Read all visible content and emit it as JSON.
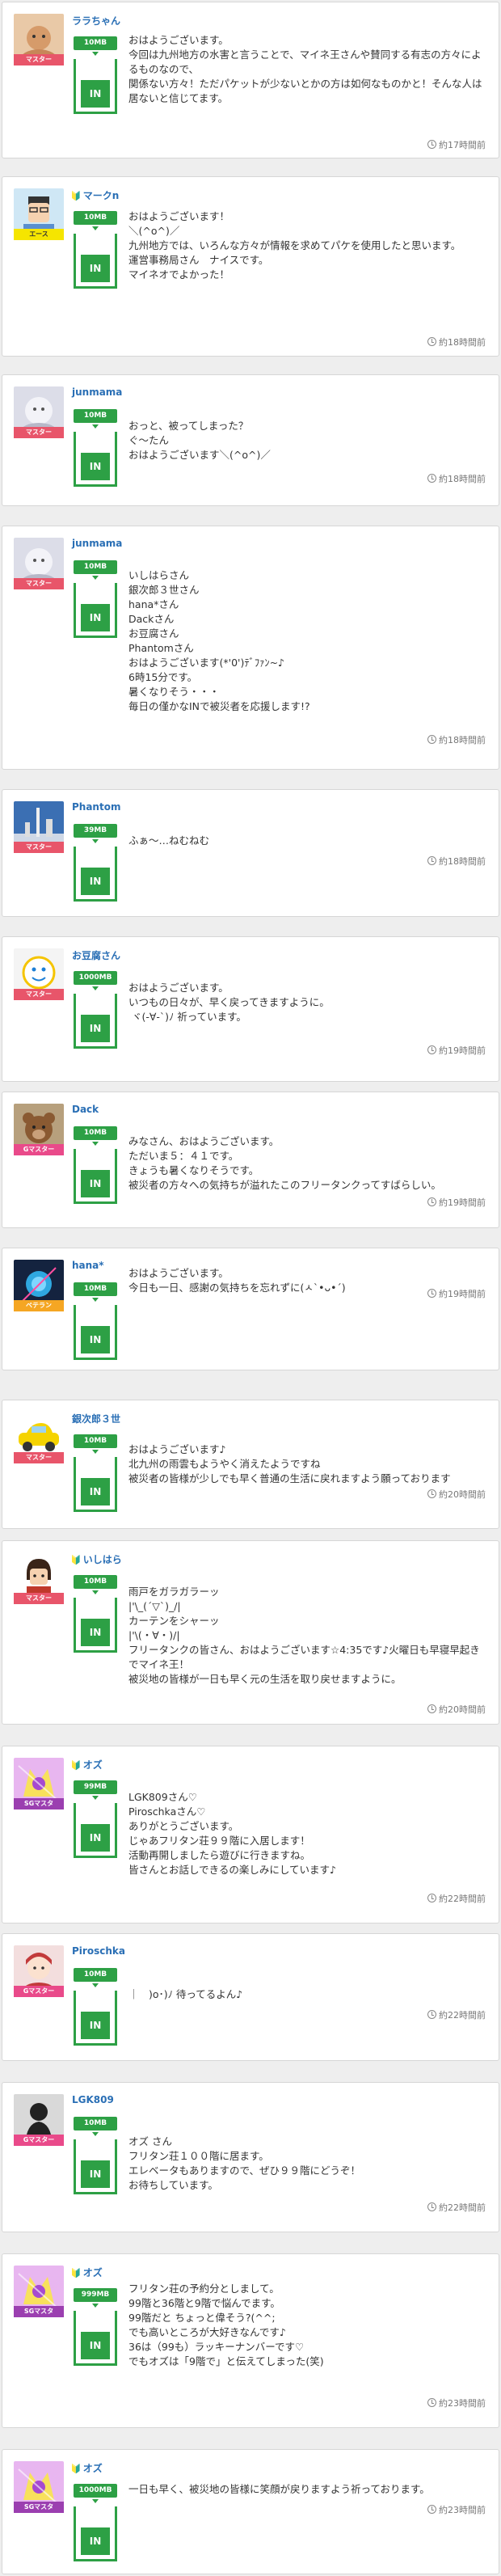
{
  "posts": [
    {
      "user": "ララちゃん",
      "badge": "",
      "rank": "マスター",
      "data": "10MB",
      "button": "IN",
      "time": "約17時間前",
      "message": "おはようございます。\n今回は九州地方の水害と言うことで、マイネ王さんや賛同する有志の方々によるものなので、\n関係ない方々！ただパケットが少ないとかの方は如何なものかと！そんな人は居ないと信じてます。"
    },
    {
      "user": "マークn",
      "badge": "🔰",
      "rank": "エース",
      "data": "10MB",
      "button": "IN",
      "time": "約18時間前",
      "message": "おはようございます！\n＼(^o^)／\n九州地方では、いろんな方々が情報を求めてパケを使用したと思います。\n運営事務局さん　ナイスです。\nマイネオでよかった！"
    },
    {
      "user": "junmama",
      "badge": "",
      "rank": "マスター",
      "data": "10MB",
      "button": "IN",
      "time": "約18時間前",
      "message": "おっと、被ってしまった？\nぐ〜たん\nおはようございます＼(^o^)／"
    },
    {
      "user": "junmama",
      "badge": "",
      "rank": "マスター",
      "data": "10MB",
      "button": "IN",
      "time": "約18時間前",
      "message": "いしはらさん\n銀次郎３世さん\nhana*さん\nDackさん\nお豆腐さん\nPhantomさん\nおはようございます(*'0')ﾃﾞﾌｧﾝ~♪\n6時15分です。\n暑くなりそう・・・\n毎日の僅かなINで被災者を応援します!?"
    },
    {
      "user": "Phantom",
      "badge": "",
      "rank": "マスター",
      "data": "39MB",
      "button": "IN",
      "time": "約18時間前",
      "message": "ふぁ〜…ねむねむ"
    },
    {
      "user": "お豆腐さん",
      "badge": "",
      "rank": "マスター",
      "data": "1000MB",
      "button": "IN",
      "time": "約19時間前",
      "message": "おはようございます。\nいつもの日々が、早く戻ってきますように。\n ヾ(-∀-`)ﾉ 祈っています。"
    },
    {
      "user": "Dack",
      "badge": "",
      "rank": "Gマスター",
      "data": "10MB",
      "button": "IN",
      "time": "約19時間前",
      "message": "みなさん、おはようございます。\nただいま５：４１です。\nきょうも暑くなりそうです。\n被災者の方々への気持ちが溢れたこのフリータンクってすばらしい。"
    },
    {
      "user": "hana*",
      "badge": "",
      "rank": "ベテラン",
      "data": "10MB",
      "button": "IN",
      "time": "約19時間前",
      "message": "おはようございます。\n今日も一日、感謝の気持ちを忘れずに(ㅅ`•ᴗ•´)"
    },
    {
      "user": "銀次郎３世",
      "badge": "",
      "rank": "マスター",
      "data": "10MB",
      "button": "IN",
      "time": "約20時間前",
      "message": "おはようございます♪\n北九州の雨雲もようやく消えたようですね\n被災者の皆様が少しでも早く普通の生活に戻れますよう願っております"
    },
    {
      "user": "いしはら",
      "badge": "🔰",
      "rank": "マスター",
      "data": "10MB",
      "button": "IN",
      "time": "約20時間前",
      "message": "雨戸をガラガラーッ\n|'\\_(´▽`)_/|\nカーテンをシャーッ\n|'\\(・∀・)/|\nフリータンクの皆さん、おはようございます☆4:35です♪火曜日も早寝早起きでマイネ王！\n被災地の皆様が一日も早く元の生活を取り戻せますように。"
    },
    {
      "user": "オズ",
      "badge": "🔰",
      "rank": "SGマスタ",
      "data": "99MB",
      "button": "IN",
      "time": "約22時間前",
      "message": "LGK809さん♡\nPiroschkaさん♡\nありがとうございます。\nじゃあフリタン荘９９階に入居します！\n活動再開しましたら遊びに行きますね。\n皆さんとお話しできるの楽しみにしています♪"
    },
    {
      "user": "Piroschka",
      "badge": "",
      "rank": "Gマスター",
      "data": "10MB",
      "button": "IN",
      "time": "約22時間前",
      "message": "｜　)o･)ﾉ 待ってるよん♪"
    },
    {
      "user": "LGK809",
      "badge": "",
      "rank": "Gマスター",
      "data": "10MB",
      "button": "IN",
      "time": "約22時間前",
      "message": "オズ さん\nフリタン荘１００階に居ます。\nエレベータもありますので、ぜひ９９階にどうぞ！\nお待ちしています。"
    },
    {
      "user": "オズ",
      "badge": "🔰",
      "rank": "SGマスタ",
      "data": "999MB",
      "button": "IN",
      "time": "約23時間前",
      "message": "フリタン荘の予約分としまして。\n99階と36階と9階で悩んでます。\n99階だと ちょっと偉そう?(^^;\nでも高いところが大好きなんです♪\n36は（99も）ラッキーナンバーです♡\nでもオズは「9階で」と伝えてしまった(笑)"
    },
    {
      "user": "オズ",
      "badge": "🔰",
      "rank": "SGマスタ",
      "data": "1000MB",
      "button": "IN",
      "time": "約23時間前",
      "message": "一日も早く、被災地の皆様に笑顔が戻りますよう祈っております。"
    }
  ]
}
